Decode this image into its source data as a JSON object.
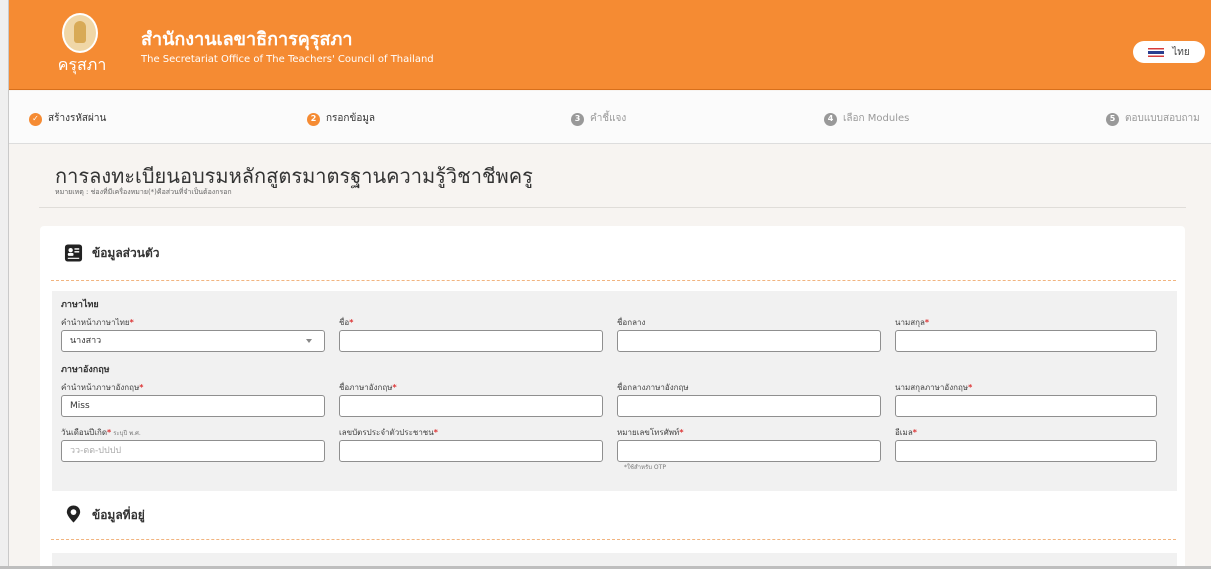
{
  "header": {
    "logo_text": "ครุสภา",
    "title_th": "สำนักงานเลขาธิการคุรุสภา",
    "title_en": "The Secretariat Office of The Teachers' Council of Thailand",
    "language_label": "ไทย"
  },
  "steps": [
    {
      "number": "",
      "label": "สร้างรหัสผ่าน",
      "state": "done"
    },
    {
      "number": "2",
      "label": "กรอกข้อมูล",
      "state": "active"
    },
    {
      "number": "3",
      "label": "คำชี้แจง",
      "state": "upcoming"
    },
    {
      "number": "4",
      "label": "เลือก Modules",
      "state": "upcoming"
    },
    {
      "number": "5",
      "label": "ตอบแบบสอบถาม",
      "state": "upcoming"
    }
  ],
  "page": {
    "title": "การลงทะเบียนอบรมหลักสูตรมาตรฐานความรู้วิชาชีพครู",
    "note": "หมายเหตุ : ช่องที่มีเครื่องหมาย(*)คือส่วนที่จำเป็นต้องกรอก"
  },
  "personal": {
    "section_title": "ข้อมูลส่วนตัว",
    "thai_group": "ภาษาไทย",
    "english_group": "ภาษาอังกฤษ",
    "title_th_label": "คำนำหน้าภาษาไทย",
    "title_th_value": "นางสาว",
    "first_name_label": "ชื่อ",
    "middle_name_label": "ชื่อกลาง",
    "last_name_label": "นามสกุล",
    "title_en_label": "คำนำหน้าภาษาอังกฤษ",
    "title_en_value": "Miss",
    "first_name_en_label": "ชื่อภาษาอังกฤษ",
    "middle_name_en_label": "ชื่อกลางภาษาอังกฤษ",
    "last_name_en_label": "นามสกุลภาษาอังกฤษ",
    "birthdate_label": "วันเดือนปีเกิด",
    "birthdate_hint": "ระบุปี พ.ศ.",
    "birthdate_placeholder": "วว-ดด-ปปปป",
    "citizen_id_label": "เลขบัตรประจำตัวประชาชน",
    "phone_label": "หมายเลขโทรศัพท์",
    "phone_note": "*ใช้สำหรับ OTP",
    "email_label": "อีเมล",
    "required_mark": "*"
  },
  "address": {
    "section_title": "ข้อมูลที่อยู่"
  },
  "colors": {
    "brand": "#f58b33",
    "required": "#dd3333"
  }
}
